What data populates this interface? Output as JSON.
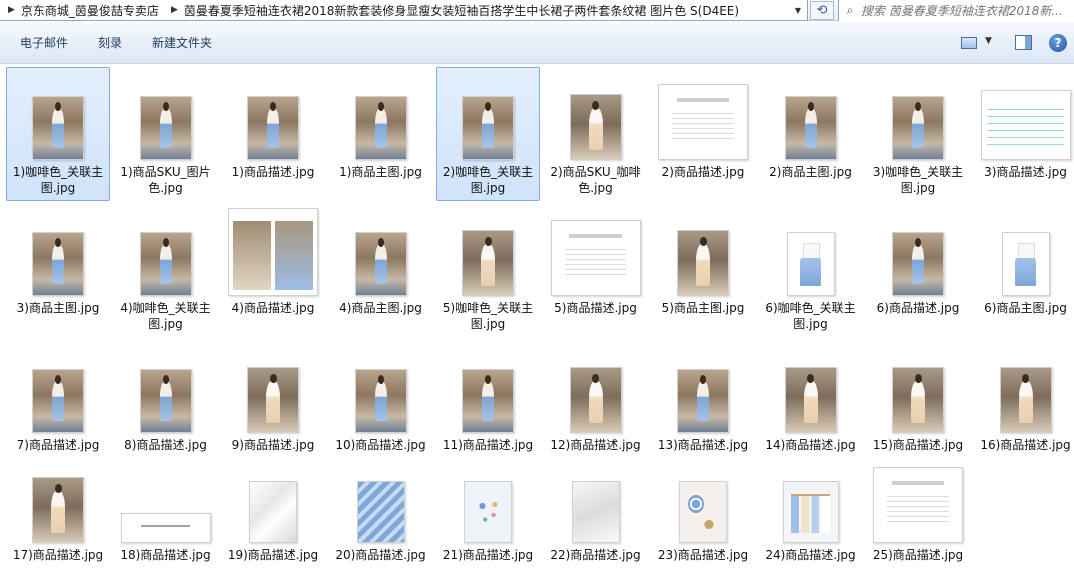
{
  "address": {
    "crumbs": [
      "京东商城_茵曼俊喆专卖店",
      "茵曼春夏季短袖连衣裙2018新款套装修身显瘦女装短袖百搭学生中长裙子两件套条纹裙 图片色 S(D4EE)"
    ]
  },
  "search": {
    "placeholder": "搜索 茵曼春夏季短袖连衣裙2018新..."
  },
  "toolbar": {
    "email": "电子邮件",
    "burn": "刻录",
    "new_folder": "新建文件夹"
  },
  "files": [
    {
      "name": "1)咖啡色_关联主图.jpg",
      "thumb": "photo",
      "selected": true
    },
    {
      "name": "1)商品SKU_图片色.jpg",
      "thumb": "photo"
    },
    {
      "name": "1)商品描述.jpg",
      "thumb": "photo"
    },
    {
      "name": "1)商品主图.jpg",
      "thumb": "photo"
    },
    {
      "name": "2)咖啡色_关联主图.jpg",
      "thumb": "photo",
      "selected": true
    },
    {
      "name": "2)商品SKU_咖啡色.jpg",
      "thumb": "photo-b"
    },
    {
      "name": "2)商品描述.jpg",
      "thumb": "white"
    },
    {
      "name": "2)商品主图.jpg",
      "thumb": "photo"
    },
    {
      "name": "3)咖啡色_关联主图.jpg",
      "thumb": "photo"
    },
    {
      "name": "3)商品描述.jpg",
      "thumb": "table"
    },
    {
      "name": "3)商品主图.jpg",
      "thumb": "photo"
    },
    {
      "name": "4)咖啡色_关联主图.jpg",
      "thumb": "photo"
    },
    {
      "name": "4)商品描述.jpg",
      "thumb": "col"
    },
    {
      "name": "4)商品主图.jpg",
      "thumb": "photo"
    },
    {
      "name": "5)咖啡色_关联主图.jpg",
      "thumb": "photo-b"
    },
    {
      "name": "5)商品描述.jpg",
      "thumb": "white"
    },
    {
      "name": "5)商品主图.jpg",
      "thumb": "photo-b"
    },
    {
      "name": "6)咖啡色_关联主图.jpg",
      "thumb": "dress"
    },
    {
      "name": "6)商品描述.jpg",
      "thumb": "photo"
    },
    {
      "name": "6)商品主图.jpg",
      "thumb": "dress"
    },
    {
      "name": "7)商品描述.jpg",
      "thumb": "photo"
    },
    {
      "name": "8)商品描述.jpg",
      "thumb": "photo"
    },
    {
      "name": "9)商品描述.jpg",
      "thumb": "photo-b"
    },
    {
      "name": "10)商品描述.jpg",
      "thumb": "photo"
    },
    {
      "name": "11)商品描述.jpg",
      "thumb": "photo"
    },
    {
      "name": "12)商品描述.jpg",
      "thumb": "photo-b"
    },
    {
      "name": "13)商品描述.jpg",
      "thumb": "photo"
    },
    {
      "name": "14)商品描述.jpg",
      "thumb": "photo-b"
    },
    {
      "name": "15)商品描述.jpg",
      "thumb": "photo-b"
    },
    {
      "name": "16)商品描述.jpg",
      "thumb": "photo-b"
    },
    {
      "name": "17)商品描述.jpg",
      "thumb": "photo-b"
    },
    {
      "name": "18)商品描述.jpg",
      "thumb": "banner"
    },
    {
      "name": "19)商品描述.jpg",
      "thumb": "fabric-w"
    },
    {
      "name": "20)商品描述.jpg",
      "thumb": "fabric-b"
    },
    {
      "name": "21)商品描述.jpg",
      "thumb": "floral"
    },
    {
      "name": "22)商品描述.jpg",
      "thumb": "fabric-w2"
    },
    {
      "name": "23)商品描述.jpg",
      "thumb": "acc"
    },
    {
      "name": "24)商品描述.jpg",
      "thumb": "rack"
    },
    {
      "name": "25)商品描述.jpg",
      "thumb": "white"
    }
  ]
}
